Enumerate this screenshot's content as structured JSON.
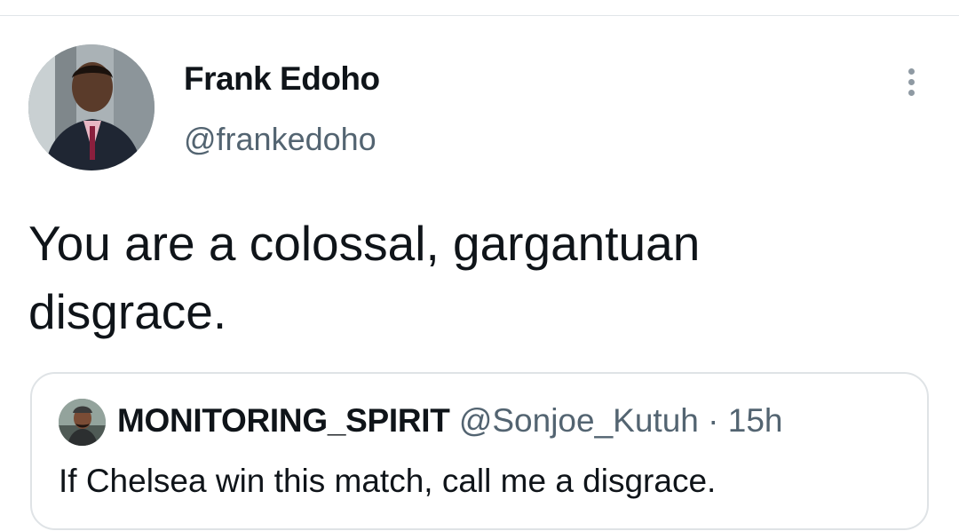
{
  "tweet": {
    "author": {
      "name": "Frank Edoho",
      "handle": "@frankedoho"
    },
    "text_line1": "You are a colossal, gargantuan",
    "text_line2": "disgrace.",
    "more_icon": "more-vertical-icon"
  },
  "quoted_tweet": {
    "name": "MONITORING_SPIRIT",
    "handle": "@Sonjoe_Kutuh",
    "separator": "·",
    "time": "15h",
    "text": "If Chelsea win this match, call me a disgrace."
  },
  "colors": {
    "primary_text": "#0f1419",
    "secondary_text": "#536471",
    "border": "#dfe3e6"
  }
}
